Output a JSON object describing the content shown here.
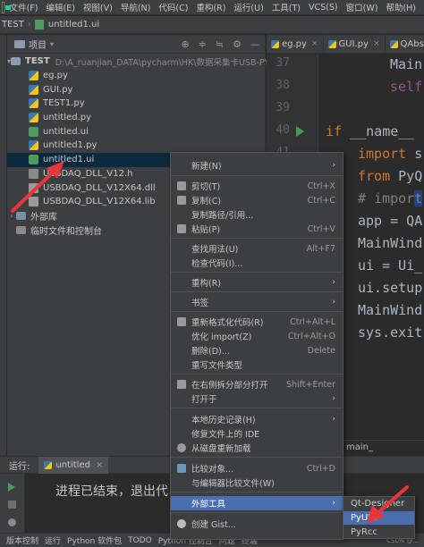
{
  "menubar": {
    "items": [
      "文件(F)",
      "编辑(E)",
      "视图(V)",
      "导航(N)",
      "代码(C)",
      "重构(R)",
      "运行(U)",
      "工具(T)",
      "VCS(S)",
      "窗口(W)",
      "帮助(H)"
    ]
  },
  "navbar": {
    "project": "TEST",
    "file": "untitled1.ui"
  },
  "project_panel": {
    "title": "项目",
    "root": {
      "name": "TEST",
      "path": "D:\\A_ruanjian_DATA\\pycharm\\HK\\数据采集卡USB-PYV"
    },
    "files": [
      "eg.py",
      "GUI.py",
      "TEST1.py",
      "untitled.py",
      "untitled.ui",
      "untitled1.py",
      "untitled1.ui",
      "USBDAQ_DLL_V12.h",
      "USBDAQ_DLL_V12X64.dll",
      "USBDAQ_DLL_V12X64.lib"
    ],
    "extra": [
      "外部库",
      "临时文件和控制台"
    ]
  },
  "editor": {
    "tabs": [
      "eg.py",
      "GUI.py",
      "QAbs"
    ],
    "line_numbers": [
      "37",
      "38",
      "39",
      "40",
      "41"
    ],
    "lines": {
      "l1": "Main",
      "l2": "self",
      "l4_kw": "if",
      "l4_rest": " __name__",
      "l5_kw": "import",
      "l5_rest": " s",
      "l6_kw": "from",
      "l6_rest": " PyQ",
      "l7_cmt": "# impor",
      "l7_hl": "t",
      "l8": "app = QA",
      "l9": "MainWind",
      "l10": "ui = Ui_",
      "l11": "ui.setup",
      "l12": "MainWind",
      "l13": "sys.exit"
    },
    "breadcrumb": "main_"
  },
  "context_menu": {
    "items": {
      "new": "新建(N)",
      "cut": "剪切(T)",
      "cut_sc": "Ctrl+X",
      "copy": "复制(C)",
      "copy_sc": "Ctrl+C",
      "copy_path": "复制路径/引用...",
      "paste": "粘贴(P)",
      "paste_sc": "Ctrl+V",
      "find_usages": "查找用法(U)",
      "find_usages_sc": "Alt+F7",
      "inspect": "检查代码(I)...",
      "refactor": "重构(R)",
      "bookmarks": "书签",
      "reformat": "重新格式化代码(R)",
      "reformat_sc": "Ctrl+Alt+L",
      "optimize": "优化 import(Z)",
      "optimize_sc": "Ctrl+Alt+O",
      "delete": "删除(D)...",
      "delete_sc": "Delete",
      "override": "重写文件类型",
      "open_right": "在右侧拆分部分打开",
      "open_right_sc": "Shift+Enter",
      "open_in": "打开于",
      "local_history": "本地历史记录(H)",
      "repair_ide": "修复文件上的 IDE",
      "reload": "从磁盘重新加载",
      "compare": "比较对象...",
      "compare_sc": "Ctrl+D",
      "compare_editor": "与编辑器比较文件(W)",
      "external_tools": "外部工具",
      "create_gist": "创建 Gist..."
    }
  },
  "submenu": {
    "items": [
      "Qt-Designer",
      "PyUIC",
      "PyRcc"
    ]
  },
  "run_panel": {
    "label": "运行:",
    "tab": "untitled",
    "output": "进程已结束，退出代"
  },
  "statusbar": {
    "items": [
      "版本控制",
      "运行",
      "Python 软件包",
      "TODO",
      "Python 控制台",
      "问题",
      "终端"
    ]
  },
  "watermark": "CSDN @...",
  "colors": {
    "accent": "#4b6eaf",
    "selection": "#0d293e",
    "annotation": "#e8353a"
  }
}
